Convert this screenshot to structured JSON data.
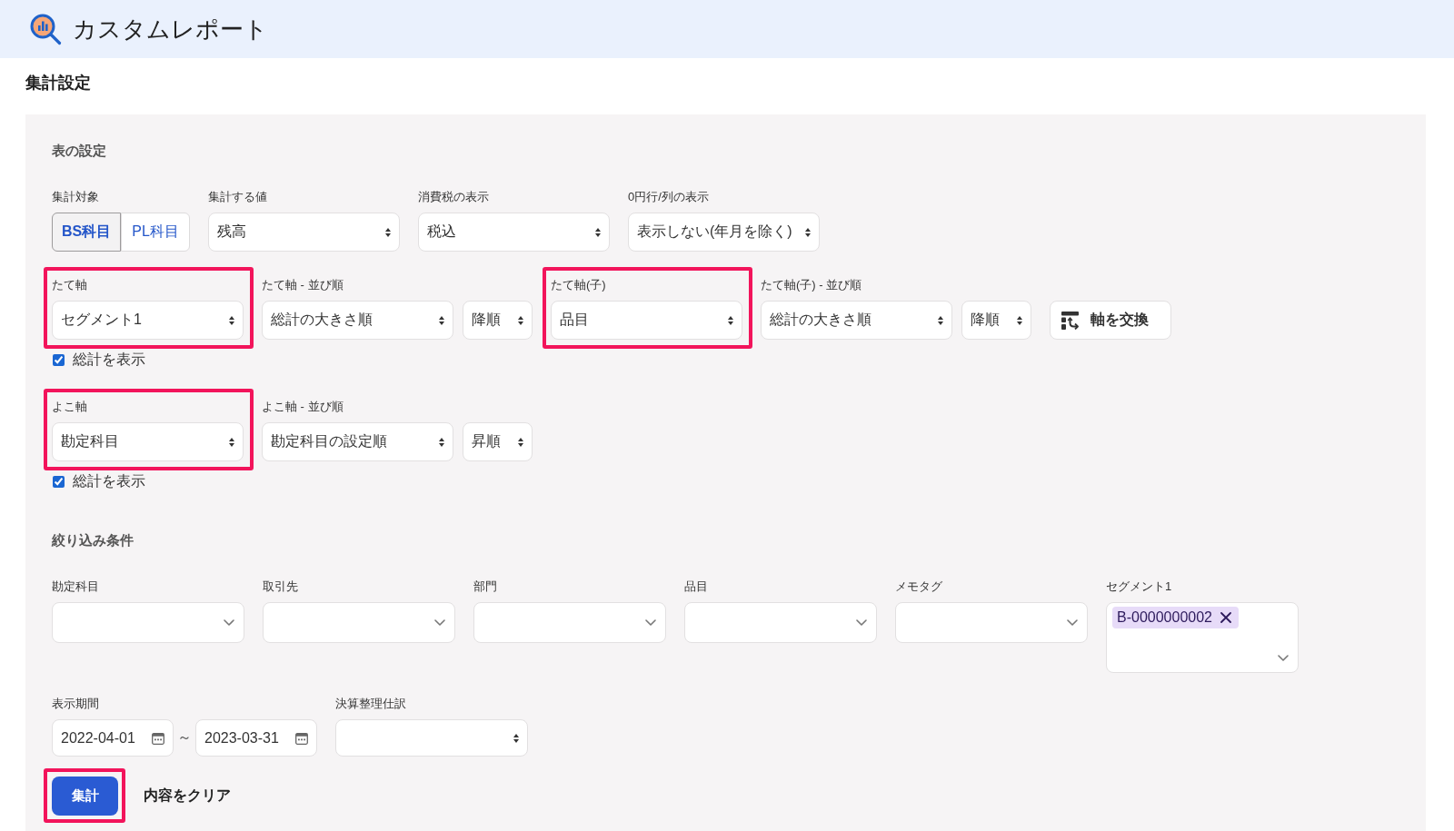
{
  "header": {
    "title": "カスタムレポート"
  },
  "section": {
    "title": "集計設定"
  },
  "table_settings": {
    "title": "表の設定",
    "rows": [
      {
        "fields": [
          {
            "kind": "segmented",
            "label": "集計対象",
            "highlighted": false,
            "options": [
              {
                "label": "BS科目",
                "selected": true
              },
              {
                "label": "PL科目",
                "selected": false
              }
            ]
          },
          {
            "kind": "select",
            "label": "集計する値",
            "value": "残高",
            "highlighted": false
          },
          {
            "kind": "select",
            "label": "消費税の表示",
            "value": "税込",
            "highlighted": false
          },
          {
            "kind": "select",
            "label": "0円行/列の表示",
            "value": "表示しない(年月を除く)",
            "highlighted": false
          }
        ]
      },
      {
        "fields": [
          {
            "kind": "select",
            "label": "たて軸",
            "value": "セグメント1",
            "highlighted": true
          },
          {
            "kind": "sort",
            "label": "たて軸 - 並び順",
            "value": "総計の大きさ順",
            "direction": "降順",
            "highlighted": false
          },
          {
            "kind": "select",
            "label": "たて軸(子)",
            "value": "品目",
            "highlighted": true
          },
          {
            "kind": "sort",
            "label": "たて軸(子) - 並び順",
            "value": "総計の大きさ順",
            "direction": "降順",
            "highlighted": false
          },
          {
            "kind": "button",
            "label": "軸を交換",
            "highlighted": false
          }
        ],
        "total": {
          "label": "総計を表示",
          "checked": true
        }
      },
      {
        "fields": [
          {
            "kind": "select",
            "label": "よこ軸",
            "value": "勘定科目",
            "highlighted": true
          },
          {
            "kind": "sort",
            "label": "よこ軸 - 並び順",
            "value": "勘定科目の設定順",
            "direction": "昇順",
            "highlighted": false
          }
        ],
        "total": {
          "label": "総計を表示",
          "checked": true
        }
      }
    ]
  },
  "filters": {
    "title": "絞り込み条件",
    "fields": [
      {
        "label": "勘定科目"
      },
      {
        "label": "取引先"
      },
      {
        "label": "部門"
      },
      {
        "label": "品目"
      },
      {
        "label": "メモタグ"
      },
      {
        "label": "セグメント1",
        "tags": [
          {
            "label": "B-0000000002"
          }
        ]
      }
    ],
    "period": {
      "label": "表示期間",
      "from": "2022-04-01",
      "separator": "～",
      "to": "2023-03-31"
    },
    "adjusting_entries": {
      "label": "決算整理仕訳"
    }
  },
  "actions": [
    {
      "kind": "primary",
      "label": "集計",
      "highlighted": true
    },
    {
      "kind": "link",
      "label": "内容をクリア",
      "highlighted": false
    }
  ]
}
